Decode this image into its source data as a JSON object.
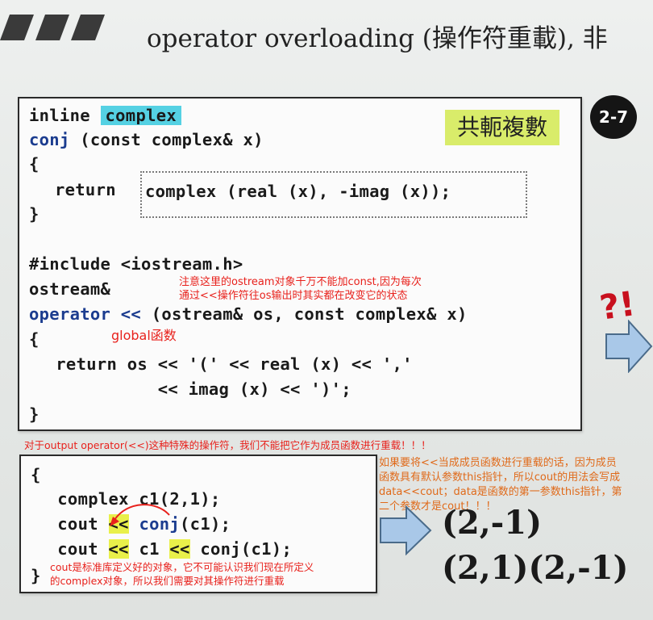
{
  "slide": {
    "title": "operator overloading (操作符重載), 非",
    "badge": "2-7",
    "conj_label": "共軛複數",
    "exclaim": "?!"
  },
  "code1": {
    "l1_kw": "inline",
    "l1_type": "complex",
    "l2_fn": "conj",
    "l2_rest": " (const complex& x)",
    "l3": "{",
    "l4_kw": "return",
    "l4_rest": "complex (real (x), -imag (x));",
    "l5": "}",
    "l6": "#include <iostream.h>",
    "l7": "ostream&",
    "l8_kw": "operator <<",
    "l8_rest": " (ostream& os, const complex& x)",
    "l9": "{",
    "l10": "  return os << '(' << real (x) << ','",
    "l11": "            << imag (x) << ')';",
    "l12": "}"
  },
  "code2": {
    "l1": "{",
    "l2": "  complex c1(2,1);",
    "l3_a": "  cout ",
    "l3_op": "<<",
    "l3_fn": "conj",
    "l3_rest": "(c1);",
    "l4_a": "  cout ",
    "l4_op1": "<<",
    "l4_mid": " c1 ",
    "l4_op2": "<<",
    "l4_rest": " conj(c1);",
    "l5": "}"
  },
  "outputs": {
    "line1": "(2,-1)",
    "line2": "(2,1)(2,-1)"
  },
  "annotations": {
    "const_note_1": "注意这里的ostream对象千万不能加const,因为每次",
    "const_note_2": "通过<<操作符往os输出时其实都在改变它的状态",
    "global": "global函数",
    "output_op": "对于output operator(<<)这种特殊的操作符，我们不能把它作为成员函数进行重载！！！",
    "member_1": "如果要将<<当成成员函数进行重载的话，因为成员",
    "member_2": "函数具有默认参数this指针，所以cout的用法会写成",
    "member_3": "data<<cout；data是函数的第一参数this指针，第",
    "member_4": "二个参数才是cout！！！",
    "cout_1": "cout是标准库定义好的对象，它不可能认识我们现在所定义",
    "cout_2": "的complex对象，所以我们需要对其操作符进行重载"
  },
  "colors": {
    "keyword": "#1b3c8f",
    "highlight_cyan": "#55d1e3",
    "highlight_yellow": "#e9f04a",
    "note_red": "#e8211c",
    "note_orange": "#e06a1a",
    "badge_bg": "#151515",
    "arrow_fill": "#a9c8e8"
  }
}
